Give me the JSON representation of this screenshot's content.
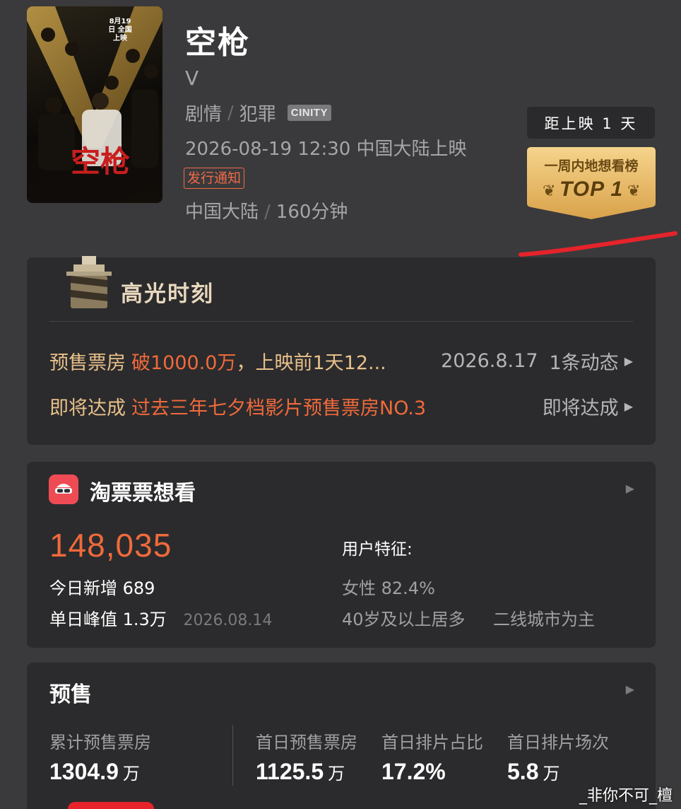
{
  "movie": {
    "title": "空枪",
    "subtitle": "V",
    "genres": [
      "剧情",
      "犯罪"
    ],
    "genre_separator": "/",
    "format_badge": "CINITY",
    "release": "2026-08-19 12:30 中国大陆上映",
    "notice_tag": "发行通知",
    "origin": "中国大陆",
    "duration": "160分钟",
    "poster": {
      "date_text": "8月19日 全国上映",
      "title_text": "空枪"
    }
  },
  "countdown": {
    "label": "距上映 1 天"
  },
  "rank_badge": {
    "caption": "一周内地想看榜",
    "value": "TOP 1",
    "colors": {
      "badge_top": "#f3cf84",
      "badge_bottom": "#d9a34a"
    }
  },
  "highlights": {
    "title": "高光时刻",
    "rows": [
      {
        "label": "预售票房",
        "value": "破1000.0万",
        "middle": "，上映前1天12...",
        "date": "2026.8.17",
        "link": "1条动态"
      },
      {
        "label": "即将达成",
        "value": "过去三年七夕档影片预售票房NO.3",
        "link": "即将达成"
      }
    ]
  },
  "want_to_watch": {
    "title": "淘票票想看",
    "app_icon": "taopiaopiao-icon",
    "count": "148,035",
    "today_label": "今日新增",
    "today_value": "689",
    "peak_label": "单日峰值",
    "peak_value": "1.3万",
    "peak_date": "2026.08.14",
    "traits_label": "用户特征:",
    "trait_gender": "女性 82.4%",
    "trait_age": "40岁及以上居多",
    "trait_city": "二线城市为主"
  },
  "presale": {
    "title": "预售",
    "stats": [
      {
        "label": "累计预售票房",
        "value": "1304.9",
        "unit": "万"
      },
      {
        "label": "首日预售票房",
        "value": "1125.5",
        "unit": "万"
      },
      {
        "label": "首日排片占比",
        "value": "17.2%",
        "unit": ""
      },
      {
        "label": "首日排片场次",
        "value": "5.8",
        "unit": "万"
      }
    ]
  },
  "watermark": "_非你不可_檀",
  "colors": {
    "background": "#3a3a3c",
    "card": "#2b2b2d",
    "accent_orange": "#f06a3b",
    "highlight_gold": "#e8c08a",
    "annotation_red": "#e6232a"
  }
}
